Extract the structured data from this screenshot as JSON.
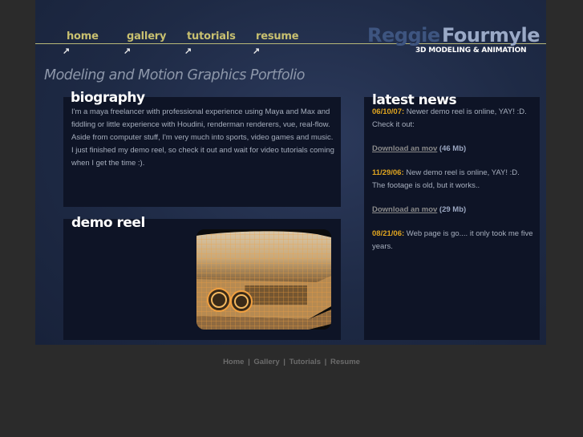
{
  "nav": {
    "items": [
      {
        "label": "home"
      },
      {
        "label": "gallery"
      },
      {
        "label": "tutorials"
      },
      {
        "label": "resume"
      }
    ],
    "arrow": "↗"
  },
  "brand": {
    "first_name": "Reggie",
    "last_name": "Fourmyle",
    "tagline": "3D MODELING & ANIMATION"
  },
  "portfolio_title": "Modeling and Motion Graphics Portfolio",
  "biography": {
    "heading": "biography",
    "text": "I'm a maya freelancer with professional experience using Maya and Max and fiddling or little experience with Houdini, renderman renderers, vue, real-flow. Aside from computer stuff, I'm very much into sports, video games and music. I just finished my demo reel, so check it out and wait for video tutorials coming when I get the time :)."
  },
  "demo_reel": {
    "heading": "demo reel"
  },
  "news": {
    "heading": "latest news",
    "entries": [
      {
        "date": "06/10/07:",
        "text": " Newer demo reel is online, YAY! :D. Check it out:"
      },
      {
        "link": "Download an mov",
        "size": " (46 Mb)"
      },
      {
        "date": "11/29/06:",
        "text": " New demo reel is online, YAY! :D. The footage is old, but it works.."
      },
      {
        "link": "Download an mov",
        "size": " (29 Mb)"
      },
      {
        "date": "08/21/06:",
        "text": " Web page is go.... it only took me five years."
      }
    ]
  },
  "footer": {
    "links": [
      "Home",
      "Gallery",
      "Tutorials",
      "Resume"
    ],
    "separator": "|"
  },
  "colors": {
    "accent_nav": "#c8c070",
    "news_date": "#e0a520",
    "panel_bg": "#0e1426",
    "page_bg": "#2b2b2b"
  }
}
